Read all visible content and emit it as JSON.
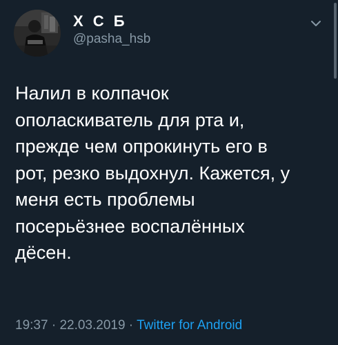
{
  "user": {
    "display_name": "Х С Б",
    "handle": "@pasha_hsb"
  },
  "tweet": {
    "text_lines": [
      "Налил в колпачок",
      "ополаскиватель для рта и,",
      "прежде чем опрокинуть его в",
      "рот, резко выдохнул. Кажется, у",
      "меня есть проблемы",
      "посерьёзнее воспалённых",
      "дёсен."
    ],
    "time": "19:37",
    "separator_1": " · ",
    "date": "22.03.2019",
    "separator_2": " · ",
    "source": "Twitter for Android"
  },
  "icons": {
    "menu": "chevron-down-icon",
    "avatar": "avatar"
  },
  "colors": {
    "background": "#15202b",
    "text": "#ffffff",
    "secondary": "#8899a6",
    "link": "#1da1f2"
  }
}
